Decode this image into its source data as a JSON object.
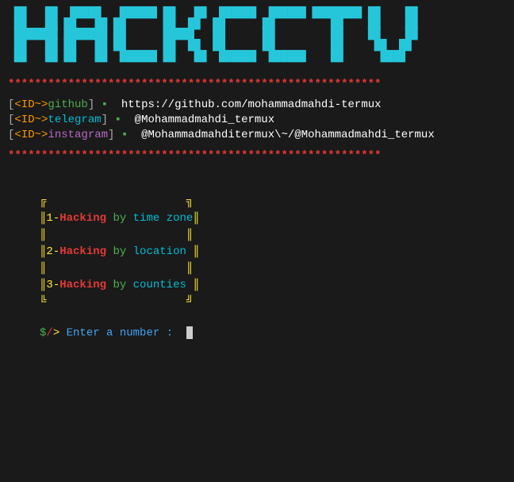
{
  "banner": {
    "text": "HACKCCTV"
  },
  "divider": "********************************************************",
  "info": {
    "id_prefix": "<ID~>",
    "github": {
      "label": "github",
      "bullet": "▪",
      "url": "https://github.com/mohammadmahdi-termux"
    },
    "telegram": {
      "label": "telegram",
      "bullet": "▪",
      "handle": "@Mohammadmahdi_termux"
    },
    "instagram": {
      "label": "instagram",
      "bullet": "▪",
      "handle": "@Mohammadmahditermux\\~/@Mohammadmahdi_termux"
    }
  },
  "menu": {
    "items": [
      {
        "num": "1",
        "action": "Hacking",
        "by": "by",
        "target": "time zone"
      },
      {
        "num": "2",
        "action": "Hacking",
        "by": "by",
        "target": "location"
      },
      {
        "num": "3",
        "action": "Hacking",
        "by": "by",
        "target": "counties"
      }
    ]
  },
  "prompt": {
    "symbol_dollar": "$",
    "symbol_slash": "/",
    "symbol_gt": ">",
    "text": "Enter a number :"
  },
  "ascii_art": " ██   ██  █████   ██████ ██   ██  ██████  ██████ ████████ ██    ██\n ██   ██ ██   ██ ██      ██  ██  ██      ██         ██    ██    ██\n ███████ ███████ ██      █████   ██      ██         ██    ██    ██\n ██   ██ ██   ██ ██      ██  ██  ██      ██         ██     ██  ██ \n ██   ██ ██   ██  ██████ ██   ██  ██████  ██████    ██      ████  "
}
